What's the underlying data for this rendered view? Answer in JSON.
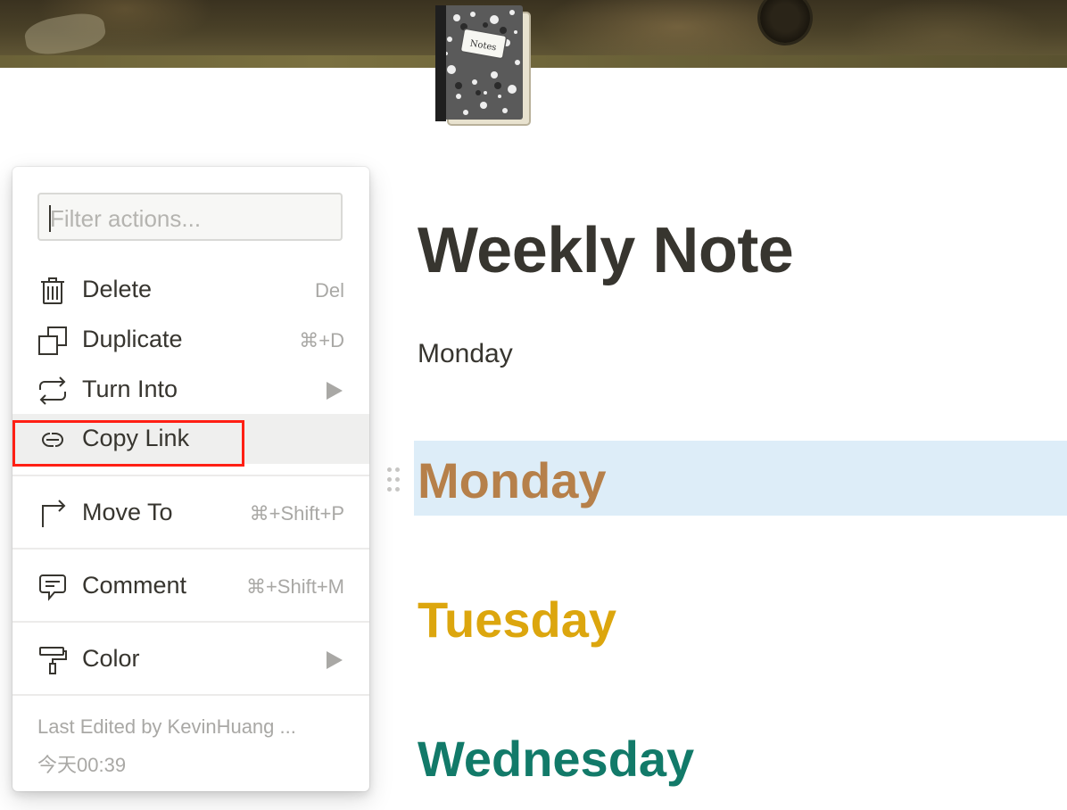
{
  "page": {
    "title": "Weekly Note",
    "icon": "notebook-icon",
    "paragraph": "Monday",
    "headings": [
      {
        "text": "Monday",
        "color": "#b6804a",
        "selected": true
      },
      {
        "text": "Tuesday",
        "color": "#dca60e"
      },
      {
        "text": "Wednesday",
        "color": "#127a69"
      }
    ]
  },
  "menu": {
    "filter_placeholder": "Filter actions...",
    "items": [
      {
        "label": "Delete",
        "shortcut": "Del",
        "icon": "trash-icon"
      },
      {
        "label": "Duplicate",
        "shortcut": "⌘+D",
        "icon": "duplicate-icon"
      },
      {
        "label": "Turn Into",
        "shortcut": "",
        "icon": "turn-into-icon",
        "submenu": true
      },
      {
        "label": "Copy Link",
        "shortcut": "",
        "icon": "link-icon",
        "hovered": true
      },
      {
        "label": "Move To",
        "shortcut": "⌘+Shift+P",
        "icon": "move-to-icon"
      },
      {
        "label": "Comment",
        "shortcut": "⌘+Shift+M",
        "icon": "comment-icon"
      },
      {
        "label": "Color",
        "shortcut": "",
        "icon": "paint-roller-icon",
        "submenu": true
      }
    ],
    "footer": {
      "edited_by": "Last Edited by KevinHuang ...",
      "time": "今天00:39"
    }
  },
  "colors": {
    "highlight_box": "#ff1f14",
    "selected_block": "#ddedf8"
  }
}
